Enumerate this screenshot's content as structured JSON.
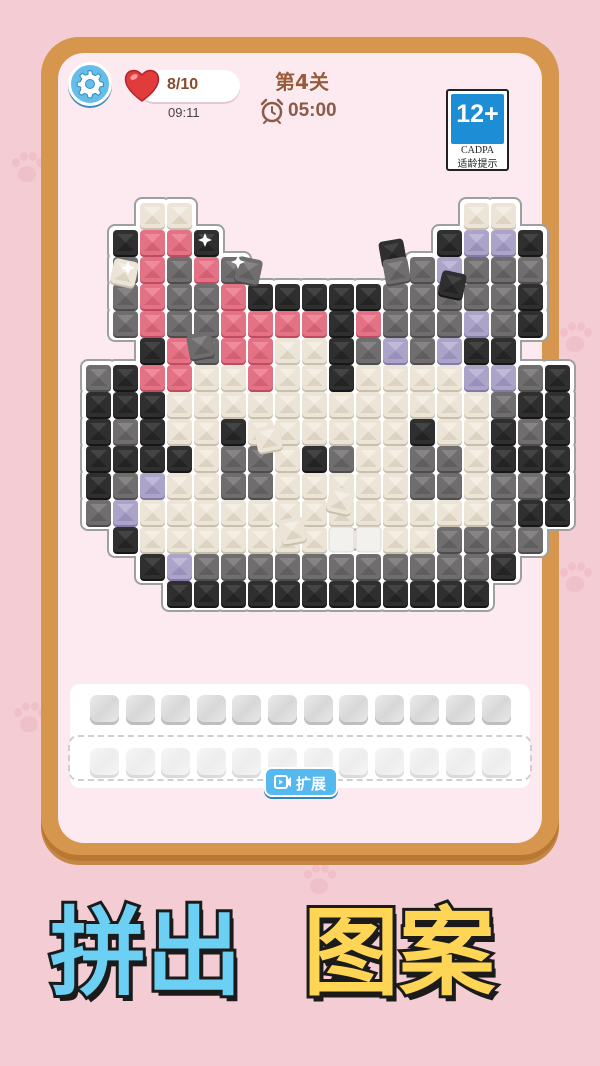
{
  "hud": {
    "settings_icon": "gear-icon",
    "lives_icon": "heart-icon",
    "lives": "8/10",
    "life_regen_time": "09:11",
    "level": "第4关",
    "timer_icon": "alarm-clock-icon",
    "timer": "05:00"
  },
  "age_rating": {
    "age": "12+",
    "org": "CADPA",
    "tip": "适龄提示"
  },
  "board": {
    "legend": {
      "W": "cream",
      "K": "black",
      "G": "dark-gray",
      "P": "pink",
      "L": "lavender"
    },
    "rows": [
      "..WW..........WW..",
      ".KPPK........KLLK.",
      ".GPGPG......GLGGG.",
      ".GPGGPKKKKKGGGGGK.",
      ".GPGGPPPPKPGGGLGK.",
      "..KPGPPWWKGLGLKK..",
      "GKPPWWPWWKWWWWLLGK",
      "KKKWWWWWWWWWWWWGKK",
      "KGKWWKWWWWWWKWWKGK",
      "KKKKWGGWKGWWGGWKKK",
      "KGLWWGGWWWWWGGWGGK",
      "GLWWWWWWWWWWWWWGKK",
      ".KWWWWWWW..WWGGGG.",
      "..KLGGGGGGGGGGGK..",
      "...KKKKKKKKKKKK..."
    ],
    "loose_tiles": [
      "K",
      "K",
      "G",
      "W",
      "W",
      "W",
      "W",
      "G",
      "G"
    ]
  },
  "tray": {
    "row1_slots": 12,
    "row2_slots": 12,
    "expand_icon": "video-icon",
    "expand_label": "扩展"
  },
  "slogan": {
    "part1": "拼出",
    "part2": "图案"
  },
  "colors": {
    "background": "#f4cdd4",
    "frame": "#d7964d",
    "panel": "#fdeaf0",
    "cream": "#ece4d6",
    "black": "#2f2f2f",
    "dark_gray": "#6f6d6e",
    "pink": "#e47285",
    "lavender": "#aca4c8",
    "accent_blue": "#55b8ee",
    "slogan_blue": "#6cd0f4",
    "slogan_yellow": "#ffd556"
  }
}
